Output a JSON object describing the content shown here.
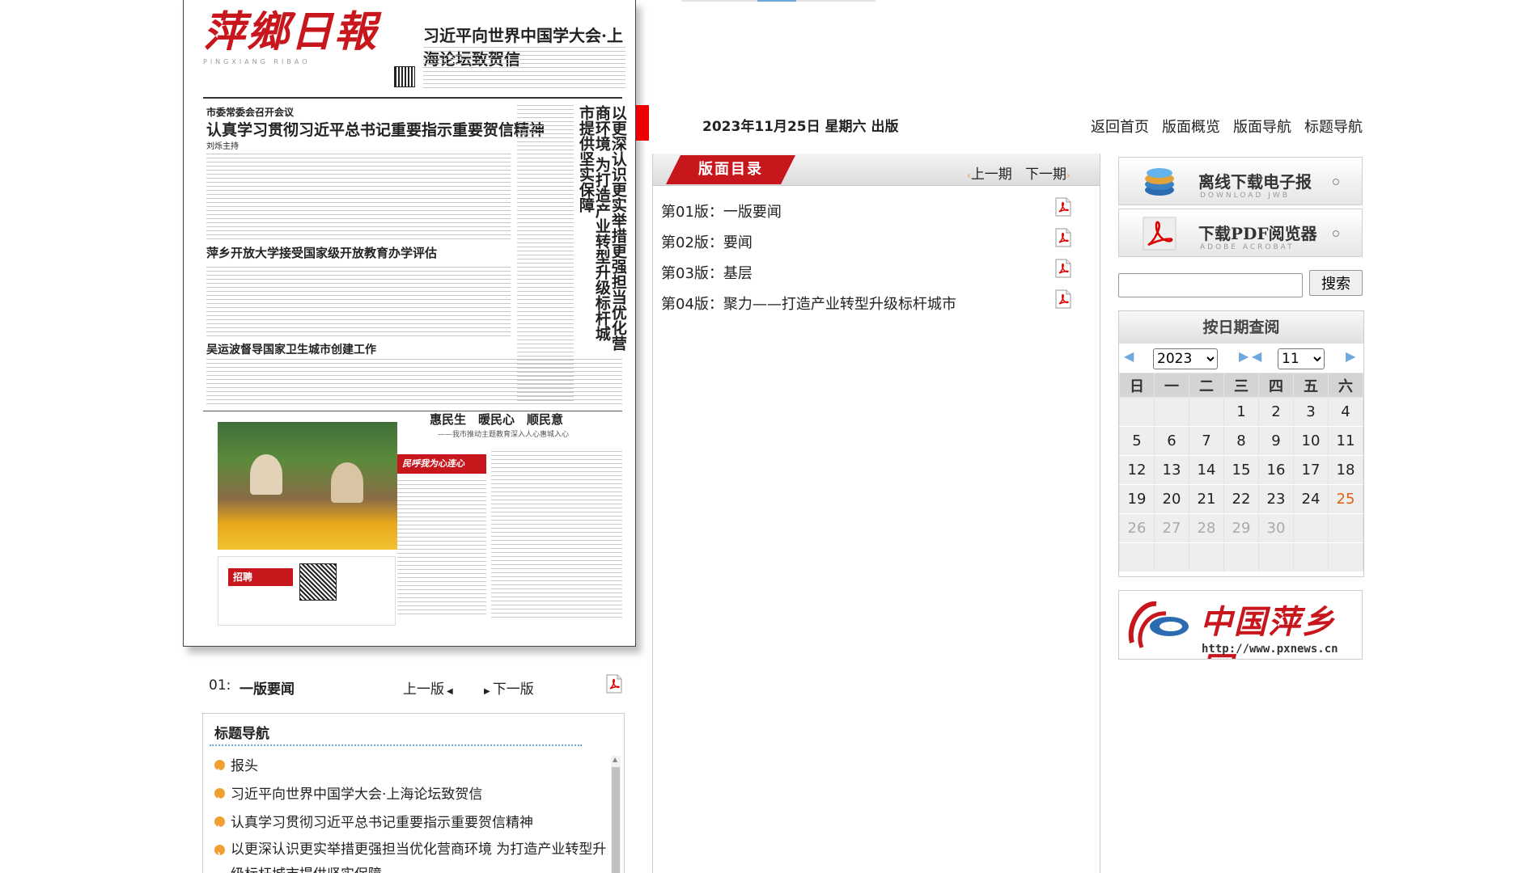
{
  "paper": {
    "masthead": "萍鄉日報",
    "masthead_sub": "PINGXIANG RIBAO",
    "headline_top": "习近平向世界中国学大会·上海论坛致贺信",
    "sec1_kicker": "市委常委会召开会议",
    "sec1_title": "认真学习贯彻习近平总书记重要指示重要贺信精神",
    "sec1_sub": "刘烁主持",
    "vertical_title": "以更深认识更实举措更强担当优化营商环境 为打造产业转型升级标杆城市提供坚实保障",
    "sec2_title": "萍乡开放大学接受国家级开放教育办学评估",
    "sec3_title": "吴运波督导国家卫生城市创建工作",
    "sec4_title": "惠民生　暖民心　顺民意",
    "sec4_sub": "——我市推动主题教育深入人心惠城入心",
    "red_banner": "民呼我为心连心",
    "ad_label": "招聘"
  },
  "page_nav": {
    "page_number": "01:",
    "page_name": "一版要闻",
    "prev_label": "上一版",
    "next_label": "下一版"
  },
  "title_nav": {
    "heading": "标题导航",
    "items": [
      "报头",
      "习近平向世界中国学大会·上海论坛致贺信",
      "认真学习贯彻习近平总书记重要指示重要贺信精神",
      "以更深认识更实举措更强担当优化营商环境 为打造产业转型升级标杆城市提供坚实保障"
    ]
  },
  "header": {
    "date": "2023年11月25日 星期六 出版",
    "nav": [
      "返回首页",
      "版面概览",
      "版面导航",
      "标题导航"
    ]
  },
  "directory": {
    "tag": "版面目录",
    "prev_label": "上一期",
    "next_label": "下一期",
    "pages": [
      "第01版：一版要闻",
      "第02版：要闻",
      "第03版：基层",
      "第04版：聚力——打造产业转型升级标杆城市"
    ]
  },
  "sidebar": {
    "download": {
      "title": "离线下载电子报",
      "sub": "DOWNLOAD JWB"
    },
    "pdf_reader": {
      "title": "下载PDF阅览器",
      "sub": "ADOBE ACROBAT"
    },
    "search_placeholder": "",
    "search_label": "搜索",
    "calendar": {
      "title": "按日期查阅",
      "year": "2023",
      "month": "11",
      "weekdays": [
        "日",
        "一",
        "二",
        "三",
        "四",
        "五",
        "六"
      ],
      "weeks": [
        [
          "",
          "",
          "",
          "1",
          "2",
          "3",
          "4"
        ],
        [
          "5",
          "6",
          "7",
          "8",
          "9",
          "10",
          "11"
        ],
        [
          "12",
          "13",
          "14",
          "15",
          "16",
          "17",
          "18"
        ],
        [
          "19",
          "20",
          "21",
          "22",
          "23",
          "24",
          "25"
        ],
        [
          "26",
          "27",
          "28",
          "29",
          "30",
          "",
          ""
        ],
        [
          "",
          "",
          "",
          "",
          "",
          "",
          ""
        ]
      ],
      "today": "25",
      "dim_from": "26"
    },
    "logo": {
      "name": "中国萍乡网",
      "url": "http://www.pxnews.cn"
    }
  },
  "colors": {
    "accent_red": "#c8161d",
    "accent_orange": "#f0a030",
    "link_blue": "#6fa8dc"
  }
}
